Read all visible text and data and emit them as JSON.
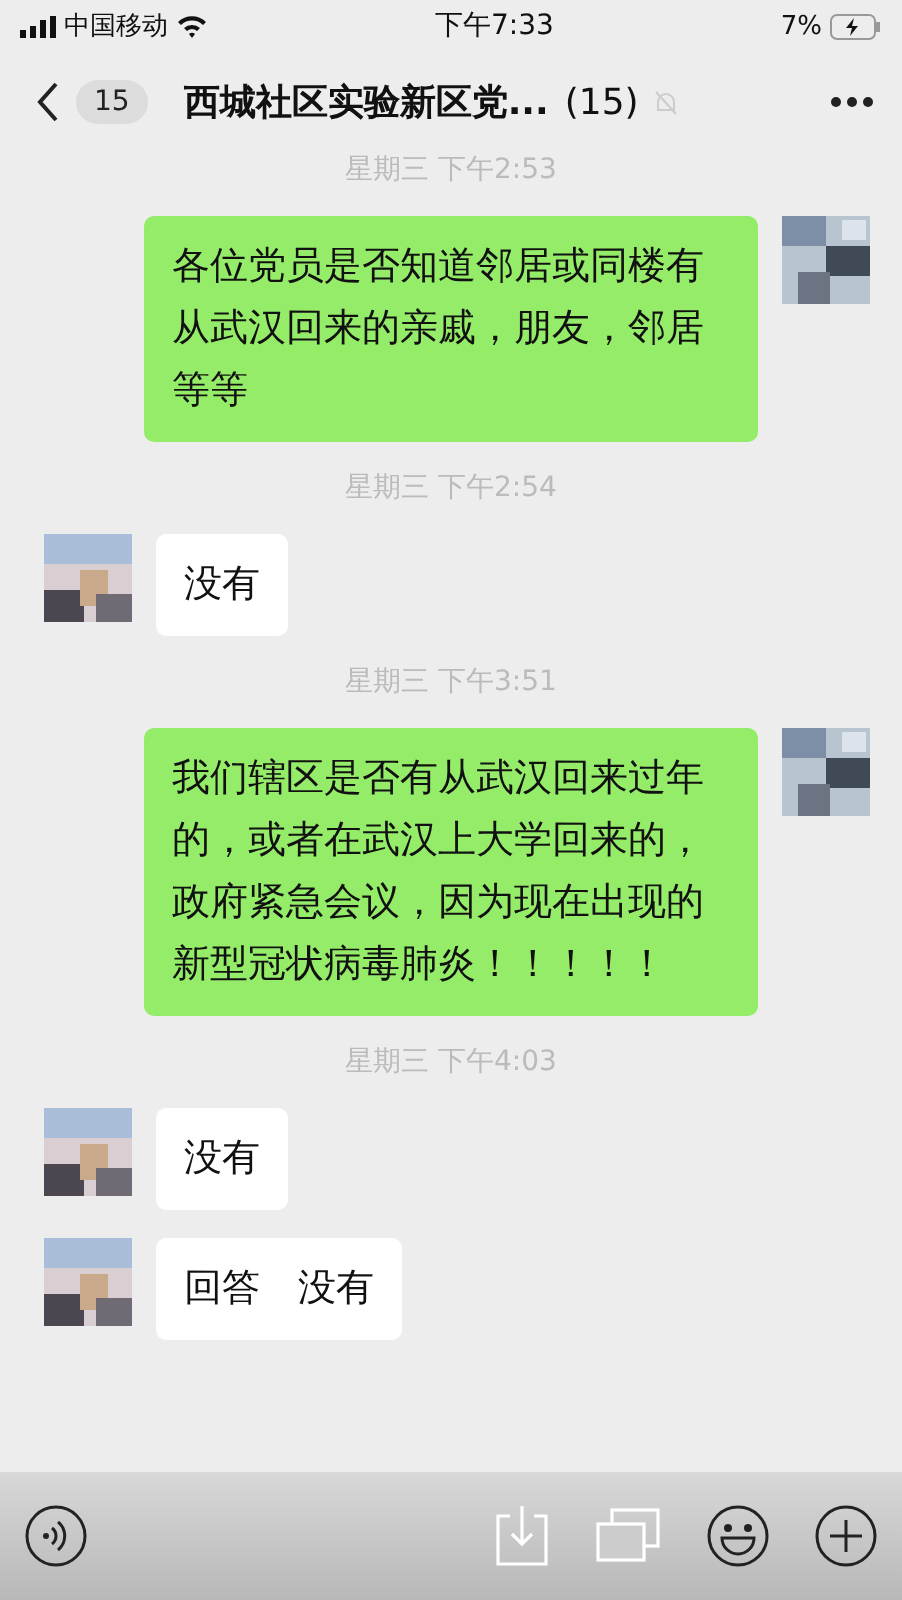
{
  "status_bar": {
    "carrier": "中国移动",
    "time": "下午7:33",
    "battery": "7%"
  },
  "nav": {
    "back_badge": "15",
    "title": "西城社区实验新区党...",
    "member_count": "(15)",
    "muted": true
  },
  "messages": [
    {
      "kind": "time",
      "text": "星期三 下午2:53"
    },
    {
      "kind": "sent",
      "text": "各位党员是否知道邻居或同楼有从武汉回来的亲戚，朋友，邻居等等"
    },
    {
      "kind": "time",
      "text": "星期三 下午2:54"
    },
    {
      "kind": "received",
      "text": "没有"
    },
    {
      "kind": "time",
      "text": "星期三 下午3:51"
    },
    {
      "kind": "sent",
      "text": "我们辖区是否有从武汉回来过年的，或者在武汉上大学回来的，政府紧急会议，因为现在出现的新型冠状病毒肺炎！！！！！"
    },
    {
      "kind": "time",
      "text": "星期三 下午4:03"
    },
    {
      "kind": "received",
      "text": "没有"
    },
    {
      "kind": "received",
      "text": "回答　没有"
    }
  ]
}
